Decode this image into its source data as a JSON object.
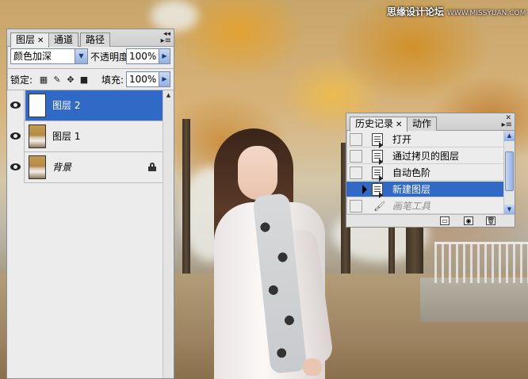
{
  "watermark": {
    "cn": "思缘设计论坛",
    "en": "WWW.MISSYUAN.COM"
  },
  "layers_panel": {
    "tabs": [
      {
        "label": "图层"
      },
      {
        "label": "通道"
      },
      {
        "label": "路径"
      }
    ],
    "blend_mode": "颜色加深",
    "opacity_label": "不透明度:",
    "opacity_value": "100%",
    "lock_label": "锁定:",
    "fill_label": "填充:",
    "fill_value": "100%",
    "layers": [
      {
        "name": "图层 2",
        "selected": true,
        "thumb": "white"
      },
      {
        "name": "图层 1",
        "selected": false,
        "thumb": "photo"
      },
      {
        "name": "背景",
        "selected": false,
        "thumb": "photo",
        "locked": true
      }
    ]
  },
  "history_panel": {
    "tabs": [
      {
        "label": "历史记录"
      },
      {
        "label": "动作"
      }
    ],
    "items": [
      {
        "label": "打开",
        "icon": "document-icon"
      },
      {
        "label": "通过拷贝的图层",
        "icon": "document-icon"
      },
      {
        "label": "自动色阶",
        "icon": "document-icon"
      },
      {
        "label": "新建图层",
        "icon": "document-icon",
        "selected": true
      },
      {
        "label": "画笔工具",
        "icon": "brush-icon",
        "future": true
      }
    ]
  }
}
